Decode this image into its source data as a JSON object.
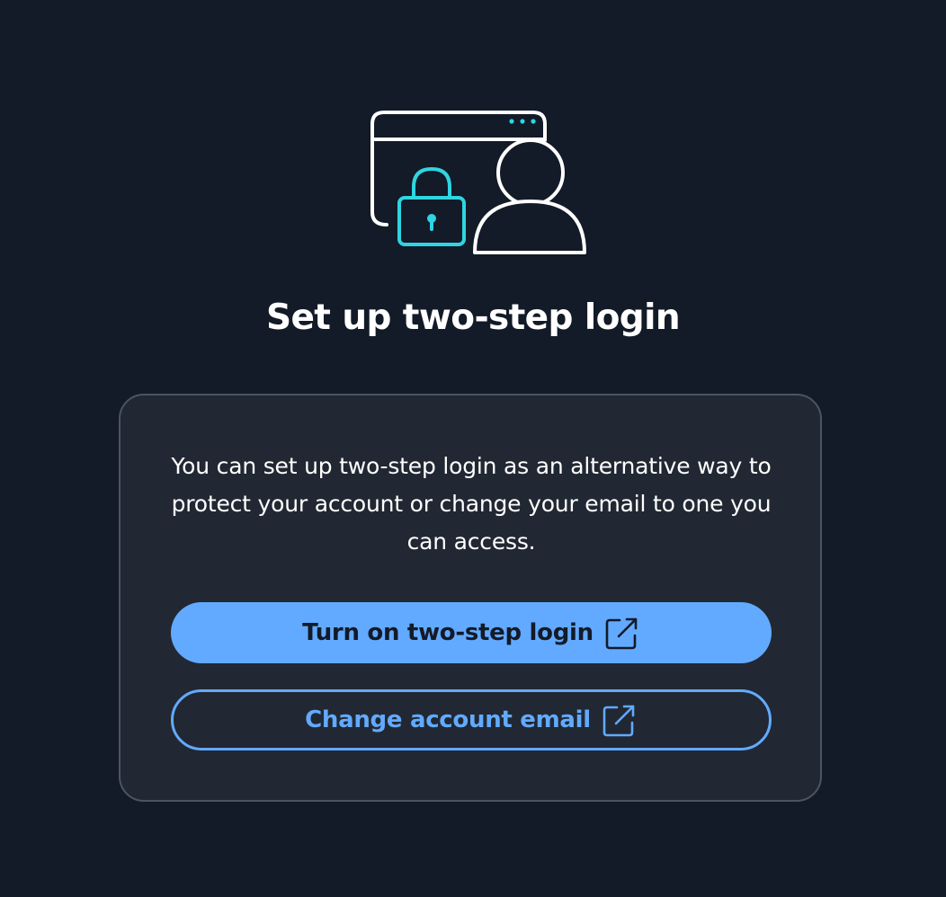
{
  "header": {
    "title": "Set up two-step login",
    "illustration_icon": "browser-lock-user-icon"
  },
  "card": {
    "description": "You can set up two-step login as an alternative way to protect your account or change your email to one you can access."
  },
  "actions": {
    "primary_label": "Turn on two-step login",
    "secondary_label": "Change account email",
    "external_icon": "external-link-icon"
  },
  "colors": {
    "background": "#131a28",
    "card_background": "#212833",
    "card_border": "#4a5563",
    "accent": "#62aaff",
    "illustration_accent": "#2fd5e0"
  }
}
